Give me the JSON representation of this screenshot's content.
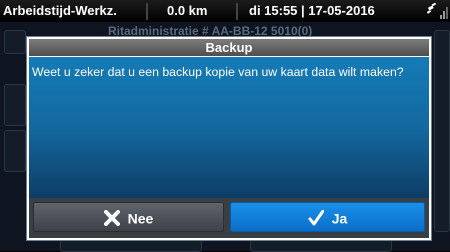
{
  "status_bar": {
    "title": "Arbeidstijd-Werkz.",
    "distance": "0.0 km",
    "datetime": "di 15:55 | 17-05-2016",
    "gps_icon": "satellite-icon",
    "signal_icon": "signal-bars-icon"
  },
  "background": {
    "header": "Ritadministratie # AA-BB-12 5010(0)"
  },
  "dialog": {
    "title": "Backup",
    "message": "Weet u zeker dat u een backup kopie van uw kaart data wilt maken?",
    "buttons": {
      "no": {
        "label": "Nee",
        "icon": "cross-icon"
      },
      "yes": {
        "label": "Ja",
        "icon": "checkmark-icon"
      }
    }
  },
  "colors": {
    "dialog_body": "#13699f",
    "yes_button": "#1a8fe8",
    "no_button": "#4a4f57"
  }
}
